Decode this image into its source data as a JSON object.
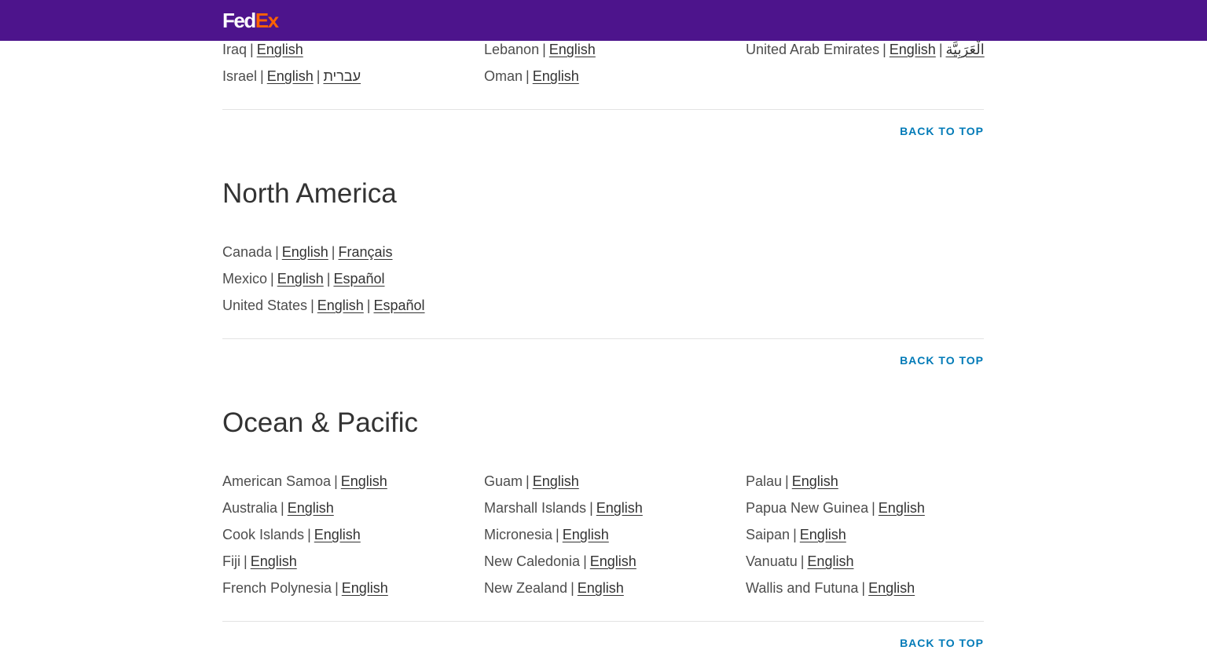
{
  "header": {
    "logo_fed": "Fed",
    "logo_ex": "Ex"
  },
  "back_to_top": "BACK TO TOP",
  "middle_east": {
    "rows": [
      [
        {
          "country": "Iraq",
          "langs": [
            "English"
          ]
        },
        {
          "country": "Lebanon",
          "langs": [
            "English"
          ]
        },
        {
          "country": "United Arab Emirates",
          "langs": [
            "English",
            "الْعَرَبِيَّة"
          ]
        }
      ],
      [
        {
          "country": "Israel",
          "langs": [
            "English",
            "עברית"
          ]
        },
        {
          "country": "Oman",
          "langs": [
            "English"
          ]
        },
        null
      ]
    ]
  },
  "north_america": {
    "title": "North America",
    "rows": [
      [
        {
          "country": "Canada",
          "langs": [
            "English",
            "Français"
          ]
        },
        null,
        null
      ],
      [
        {
          "country": "Mexico",
          "langs": [
            "English",
            "Español"
          ]
        },
        null,
        null
      ],
      [
        {
          "country": "United States",
          "langs": [
            "English",
            "Español"
          ]
        },
        null,
        null
      ]
    ]
  },
  "ocean_pacific": {
    "title": "Ocean & Pacific",
    "rows": [
      [
        {
          "country": "American Samoa",
          "langs": [
            "English"
          ]
        },
        {
          "country": "Guam",
          "langs": [
            "English"
          ]
        },
        {
          "country": "Palau",
          "langs": [
            "English"
          ]
        }
      ],
      [
        {
          "country": "Australia",
          "langs": [
            "English"
          ]
        },
        {
          "country": "Marshall Islands",
          "langs": [
            "English"
          ]
        },
        {
          "country": "Papua New Guinea",
          "langs": [
            "English"
          ]
        }
      ],
      [
        {
          "country": "Cook Islands",
          "langs": [
            "English"
          ]
        },
        {
          "country": "Micronesia",
          "langs": [
            "English"
          ]
        },
        {
          "country": "Saipan",
          "langs": [
            "English"
          ]
        }
      ],
      [
        {
          "country": "Fiji",
          "langs": [
            "English"
          ]
        },
        {
          "country": "New Caledonia",
          "langs": [
            "English"
          ]
        },
        {
          "country": "Vanuatu",
          "langs": [
            "English"
          ]
        }
      ],
      [
        {
          "country": "French Polynesia",
          "langs": [
            "English"
          ]
        },
        {
          "country": "New Zealand",
          "langs": [
            "English"
          ]
        },
        {
          "country": "Wallis and Futuna",
          "langs": [
            "English"
          ]
        }
      ]
    ]
  },
  "colors": {
    "brand_purple": "#4d148c",
    "brand_orange": "#ff6200",
    "link_blue": "#007ab7"
  }
}
